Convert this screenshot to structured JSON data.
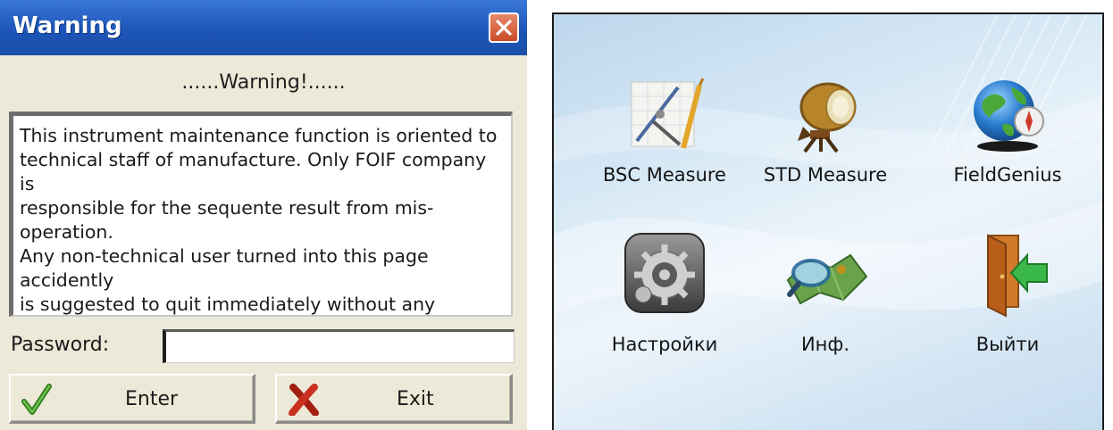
{
  "dialog": {
    "title": "Warning",
    "heading": "......Warning!......",
    "message": "This instrument maintenance function is oriented to\ntechnical staff of manufacture. Only FOIF company is\nresponsible for the sequente result from mis-operation.\nAny non-technical user turned into this page accidently\nis suggested to quit immediately without any modifying\naction.",
    "password_label": "Password:",
    "password_value": "",
    "enter_label": "Enter",
    "exit_label": "Exit"
  },
  "launcher": {
    "apps": [
      {
        "label": "BSC Measure",
        "icon": "drafting-compass-icon"
      },
      {
        "label": "STD Measure",
        "icon": "surveying-instrument-icon"
      },
      {
        "label": "FieldGenius",
        "icon": "globe-compass-icon"
      },
      {
        "label": "Настройки",
        "icon": "settings-gears-icon"
      },
      {
        "label": "Инф.",
        "icon": "map-magnifier-icon"
      },
      {
        "label": "Выйти",
        "icon": "exit-door-icon"
      }
    ]
  },
  "colors": {
    "title_bar": "#1d55b8",
    "dialog_bg": "#ece9d8",
    "close_button": "#cc4a2a",
    "enter_check": "#3a9a2a",
    "exit_cross": "#c02a1a"
  }
}
